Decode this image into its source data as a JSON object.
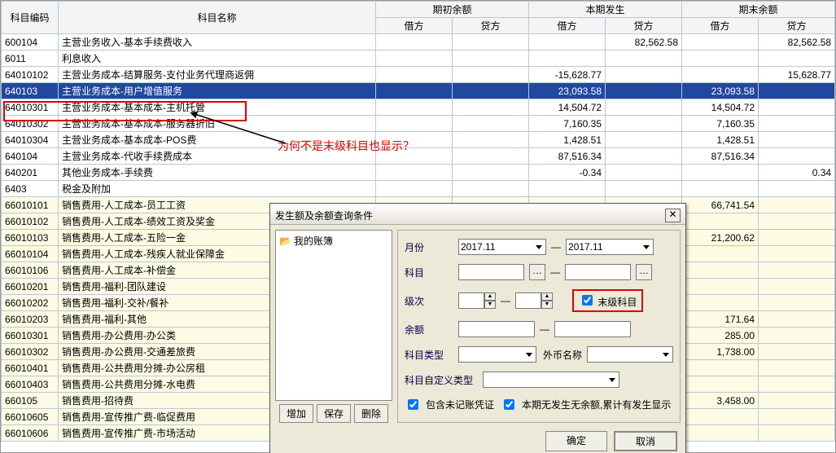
{
  "headers": {
    "code": "科目编码",
    "name": "科目名称",
    "opening": "期初余额",
    "current": "本期发生",
    "closing": "期末余额",
    "debit": "借方",
    "credit": "贷方"
  },
  "annotation": "为何不是末级科目也显示？",
  "rows": [
    {
      "code": "600104",
      "name": "   主营业务收入-基本手续费收入",
      "d1": "",
      "c1": "",
      "d2": "",
      "c2": "82,562.58",
      "d3": "",
      "c3": "82,562.58"
    },
    {
      "code": "6011",
      "name": "利息收入",
      "d1": "",
      "c1": "",
      "d2": "",
      "c2": "",
      "d3": "",
      "c3": ""
    },
    {
      "code": "64010102",
      "name": "       主营业务成本-结算服务-支付业务代理商返佣",
      "d1": "",
      "c1": "",
      "d2": "-15,628.77",
      "c2": "",
      "d3": "",
      "c3": "15,628.77"
    },
    {
      "code": "640103",
      "name": "   主营业务成本-用户增值服务",
      "d1": "",
      "c1": "",
      "d2": "23,093.58",
      "c2": "",
      "d3": "23,093.58",
      "c3": "",
      "sel": true
    },
    {
      "code": "64010301",
      "name": "       主营业务成本-基本成本-主机托管",
      "d1": "",
      "c1": "",
      "d2": "14,504.72",
      "c2": "",
      "d3": "14,504.72",
      "c3": ""
    },
    {
      "code": "64010302",
      "name": "       主营业务成本-基本成本-服务器折旧",
      "d1": "",
      "c1": "",
      "d2": "7,160.35",
      "c2": "",
      "d3": "7,160.35",
      "c3": ""
    },
    {
      "code": "64010304",
      "name": "       主营业务成本-基本成本-POS费",
      "d1": "",
      "c1": "",
      "d2": "1,428.51",
      "c2": "",
      "d3": "1,428.51",
      "c3": ""
    },
    {
      "code": "640104",
      "name": "   主营业务成本-代收手续费成本",
      "d1": "",
      "c1": "",
      "d2": "87,516.34",
      "c2": "",
      "d3": "87,516.34",
      "c3": ""
    },
    {
      "code": "640201",
      "name": "   其他业务成本-手续费",
      "d1": "",
      "c1": "",
      "d2": "-0.34",
      "c2": "",
      "d3": "",
      "c3": "0.34"
    },
    {
      "code": "6403",
      "name": "税金及附加",
      "d1": "",
      "c1": "",
      "d2": "",
      "c2": "",
      "d3": "",
      "c3": ""
    },
    {
      "code": "66010101",
      "name": "       销售费用-人工成本-员工工资",
      "d1": "",
      "c1": "",
      "d2": "",
      "c2": "",
      "d3": "66,741.54",
      "c3": "",
      "y": true
    },
    {
      "code": "66010102",
      "name": "       销售费用-人工成本-绩效工资及奖金",
      "d1": "",
      "c1": "",
      "d2": "",
      "c2": "",
      "d3": "",
      "c3": "",
      "y": true
    },
    {
      "code": "66010103",
      "name": "       销售费用-人工成本-五险一金",
      "d1": "",
      "c1": "",
      "d2": "",
      "c2": "",
      "d3": "21,200.62",
      "c3": "",
      "y": true
    },
    {
      "code": "66010104",
      "name": "       销售费用-人工成本-残疾人就业保障金",
      "d1": "",
      "c1": "",
      "d2": "",
      "c2": "",
      "d3": "",
      "c3": "",
      "y": true
    },
    {
      "code": "66010106",
      "name": "       销售费用-人工成本-补偿金",
      "d1": "",
      "c1": "",
      "d2": "",
      "c2": "",
      "d3": "",
      "c3": "",
      "y": true
    },
    {
      "code": "66010201",
      "name": "       销售费用-福利-团队建设",
      "d1": "",
      "c1": "",
      "d2": "",
      "c2": "",
      "d3": "",
      "c3": "",
      "y": true
    },
    {
      "code": "66010202",
      "name": "       销售费用-福利-交补/餐补",
      "d1": "",
      "c1": "",
      "d2": "",
      "c2": "",
      "d3": "",
      "c3": "",
      "y": true
    },
    {
      "code": "66010203",
      "name": "       销售费用-福利-其他",
      "d1": "",
      "c1": "",
      "d2": "",
      "c2": "",
      "d3": "171.64",
      "c3": "",
      "y": true
    },
    {
      "code": "66010301",
      "name": "       销售费用-办公费用-办公类",
      "d1": "",
      "c1": "",
      "d2": "",
      "c2": "",
      "d3": "285.00",
      "c3": "",
      "y": true
    },
    {
      "code": "66010302",
      "name": "       销售费用-办公费用-交通差旅费",
      "d1": "",
      "c1": "",
      "d2": "",
      "c2": "",
      "d3": "1,738.00",
      "c3": "",
      "y": true
    },
    {
      "code": "66010401",
      "name": "       销售费用-公共费用分摊-办公房租",
      "d1": "",
      "c1": "",
      "d2": "",
      "c2": "",
      "d3": "",
      "c3": "",
      "y": true
    },
    {
      "code": "66010403",
      "name": "       销售费用-公共费用分摊-水电费",
      "d1": "",
      "c1": "",
      "d2": "",
      "c2": "",
      "d3": "",
      "c3": "",
      "y": true
    },
    {
      "code": "660105",
      "name": "   销售费用-招待费",
      "d1": "",
      "c1": "",
      "d2": "",
      "c2": "",
      "d3": "3,458.00",
      "c3": "",
      "y": true
    },
    {
      "code": "66010605",
      "name": "       销售费用-宣传推广费-临促费用",
      "d1": "",
      "c1": "",
      "d2": "",
      "c2": "",
      "d3": "",
      "c3": "",
      "y": true
    },
    {
      "code": "66010606",
      "name": "       销售费用-宣传推广费-市场活动",
      "d1": "",
      "c1": "",
      "d2": "",
      "c2": "",
      "d3": "",
      "c3": "",
      "y": true
    }
  ],
  "dialog": {
    "title": "发生额及余额查询条件",
    "tree_root": "我的账簿",
    "btn_add": "增加",
    "btn_save": "保存",
    "btn_del": "删除",
    "lab_month": "月份",
    "month_from": "2017.11",
    "month_to": "2017.11",
    "lab_account": "科目",
    "lab_level": "级次",
    "level_from": "",
    "level_to": "",
    "chk_leaf": "末级科目",
    "lab_balance": "余额",
    "lab_type": "科目类型",
    "lab_currency": "外币名称",
    "lab_custom": "科目自定义类型",
    "chk_unposted": "包含未记账凭证",
    "chk_cumulative": "本期无发生无余额,累计有发生显示",
    "btn_ok": "确定",
    "btn_cancel": "取消",
    "dash": "—"
  }
}
